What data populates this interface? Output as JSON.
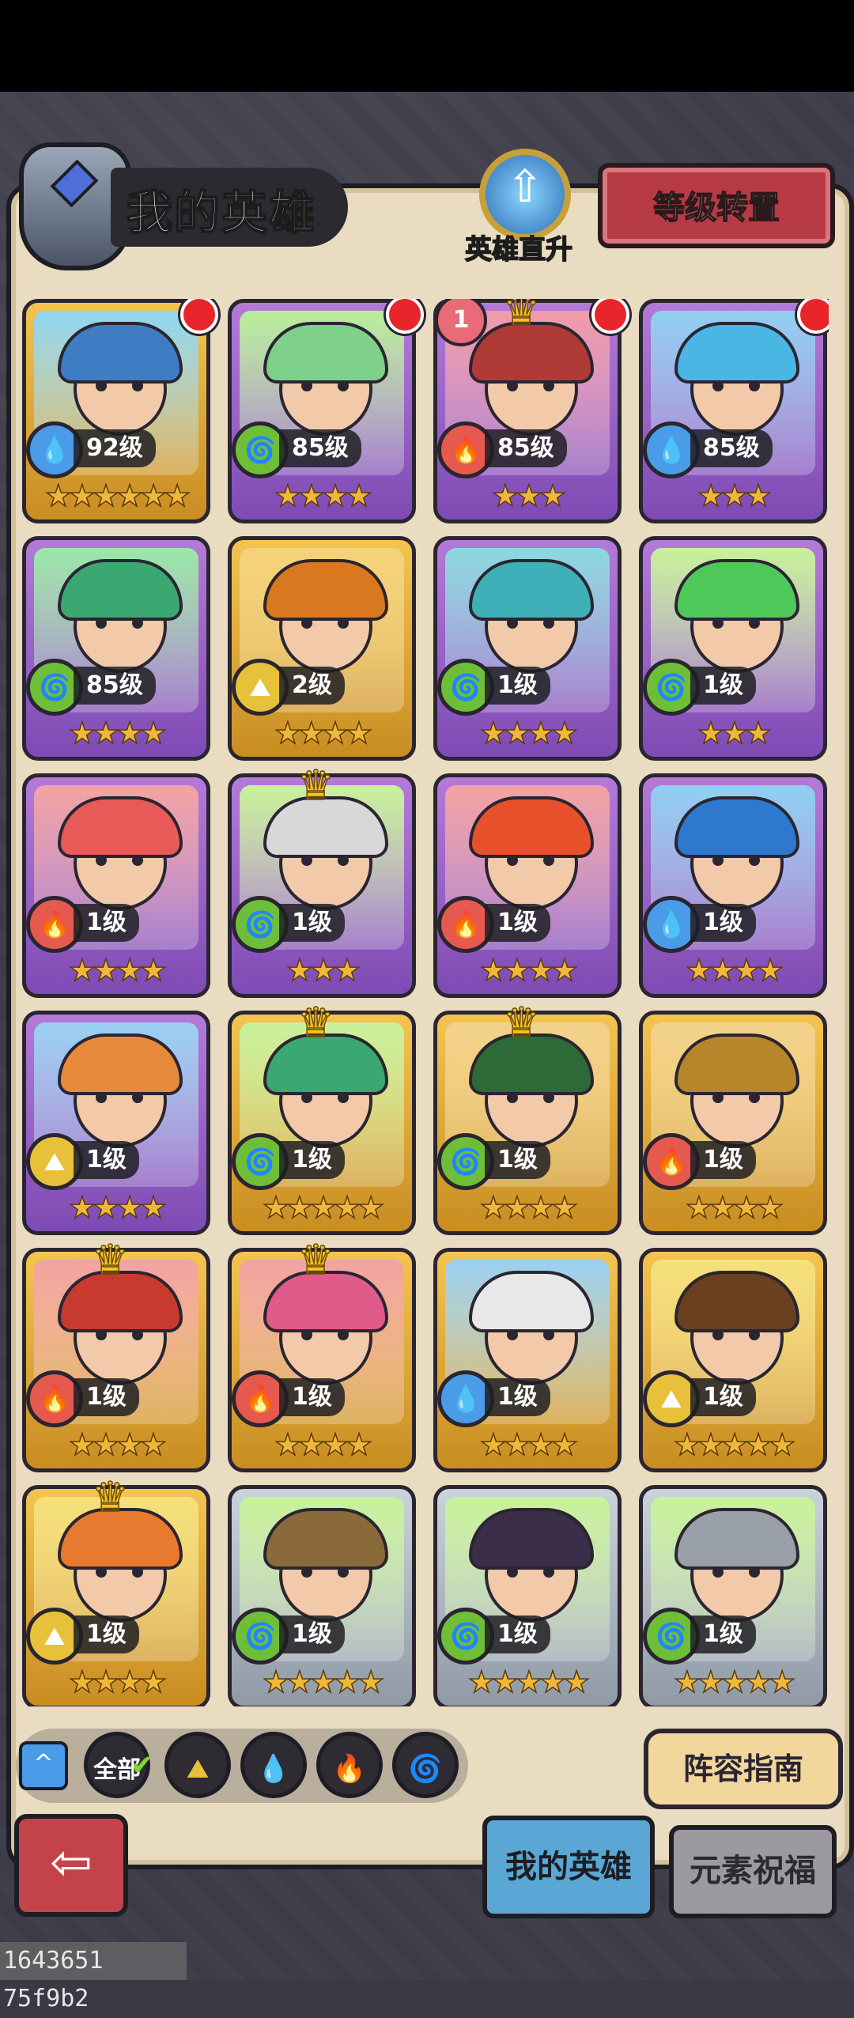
{
  "header": {
    "title": "我的英雄",
    "direct_up_label": "英雄直升",
    "level_transfer_label": "等级转置"
  },
  "heroes": [
    {
      "element": "water",
      "level": "92级",
      "stars": "★★★★★★",
      "tier": "gold",
      "reddot": true
    },
    {
      "element": "wind",
      "level": "85级",
      "stars": "★★★★",
      "tier": "purple",
      "reddot": true
    },
    {
      "element": "fire",
      "level": "85级",
      "stars": "★★★",
      "tier": "purple",
      "reddot": true,
      "badge": "1",
      "crown": true
    },
    {
      "element": "water",
      "level": "85级",
      "stars": "★★★",
      "tier": "purple",
      "reddot": true
    },
    {
      "element": "wind",
      "level": "85级",
      "stars": "★★★★",
      "tier": "purple"
    },
    {
      "element": "earth",
      "level": "2级",
      "stars": "★★★★",
      "tier": "gold"
    },
    {
      "element": "wind",
      "level": "1级",
      "stars": "★★★★",
      "tier": "purple"
    },
    {
      "element": "wind",
      "level": "1级",
      "stars": "★★★",
      "tier": "purple"
    },
    {
      "element": "fire",
      "level": "1级",
      "stars": "★★★★",
      "tier": "purple"
    },
    {
      "element": "wind",
      "level": "1级",
      "stars": "★★★",
      "tier": "purple",
      "crown": true
    },
    {
      "element": "fire",
      "level": "1级",
      "stars": "★★★★",
      "tier": "purple"
    },
    {
      "element": "water",
      "level": "1级",
      "stars": "★★★★",
      "tier": "purple"
    },
    {
      "element": "earth",
      "level": "1级",
      "stars": "★★★★",
      "tier": "purple"
    },
    {
      "element": "wind",
      "level": "1级",
      "stars": "★★★★★",
      "tier": "gold",
      "crown": true
    },
    {
      "element": "wind",
      "level": "1级",
      "stars": "★★★★",
      "tier": "gold",
      "crown": true
    },
    {
      "element": "fire",
      "level": "1级",
      "stars": "★★★★",
      "tier": "gold"
    },
    {
      "element": "fire",
      "level": "1级",
      "stars": "★★★★",
      "tier": "gold",
      "crown": true
    },
    {
      "element": "fire",
      "level": "1级",
      "stars": "★★★★",
      "tier": "gold",
      "crown": true
    },
    {
      "element": "water",
      "level": "1级",
      "stars": "★★★★",
      "tier": "gold"
    },
    {
      "element": "earth",
      "level": "1级",
      "stars": "★★★★★",
      "tier": "gold"
    },
    {
      "element": "earth",
      "level": "1级",
      "stars": "★★★★",
      "tier": "gold",
      "crown": true
    },
    {
      "element": "wind",
      "level": "1级",
      "stars": "★★★★★",
      "tier": "silver"
    },
    {
      "element": "wind",
      "level": "1级",
      "stars": "★★★★★",
      "tier": "silver"
    },
    {
      "element": "wind",
      "level": "1级",
      "stars": "★★★★★",
      "tier": "silver"
    }
  ],
  "filters": {
    "all_label": "全部",
    "element_icons": [
      "earth-icon",
      "water-icon",
      "fire-icon",
      "wind-icon"
    ]
  },
  "guide_label": "阵容指南",
  "tabs": {
    "my_heroes": "我的英雄",
    "element_blessing": "元素祝福"
  },
  "watermark": "1643651 75f9b2",
  "colors": {
    "water": "#4a9be8",
    "wind": "#6fbe38",
    "fire": "#e6594f",
    "earth": "#e8c13a"
  }
}
